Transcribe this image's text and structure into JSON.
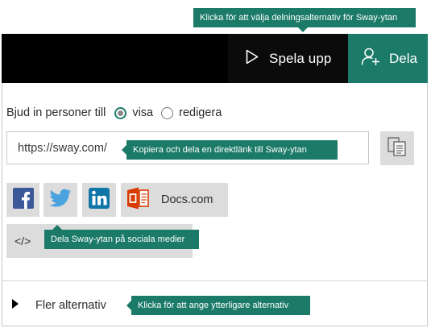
{
  "callouts": {
    "share_options": "Klicka för att välja delningsalternativ för Sway-ytan",
    "copy_link": "Kopiera och dela en direktlänk till Sway-ytan",
    "social": "Dela Sway-ytan på sociala medier",
    "more_options": "Klicka för att ange ytterligare alternativ"
  },
  "toolbar": {
    "play_label": "Spela upp",
    "share_label": "Dela"
  },
  "invite": {
    "label": "Bjud in personer till",
    "options": [
      {
        "label": "visa",
        "selected": true
      },
      {
        "label": "redigera",
        "selected": false
      }
    ]
  },
  "link": {
    "url": "https://sway.com/"
  },
  "social": {
    "docs_label": "Docs.com",
    "embed_label": "</>"
  },
  "more": {
    "label": "Fler alternativ"
  },
  "colors": {
    "accent": "#1b7a68",
    "toolbar_bg": "#000000",
    "button_bg": "#dcdcdc",
    "facebook": "#3b5998",
    "twitter": "#4aa3df",
    "linkedin": "#0e76a8",
    "office": "#d83b01"
  },
  "icons": {
    "play": "play-outline-icon",
    "share": "add-person-icon",
    "copy": "copy-clipboard-icon",
    "facebook": "facebook-icon",
    "twitter": "twitter-icon",
    "linkedin": "linkedin-icon",
    "docs": "docs-com-icon",
    "more": "expand-triangle-icon"
  }
}
